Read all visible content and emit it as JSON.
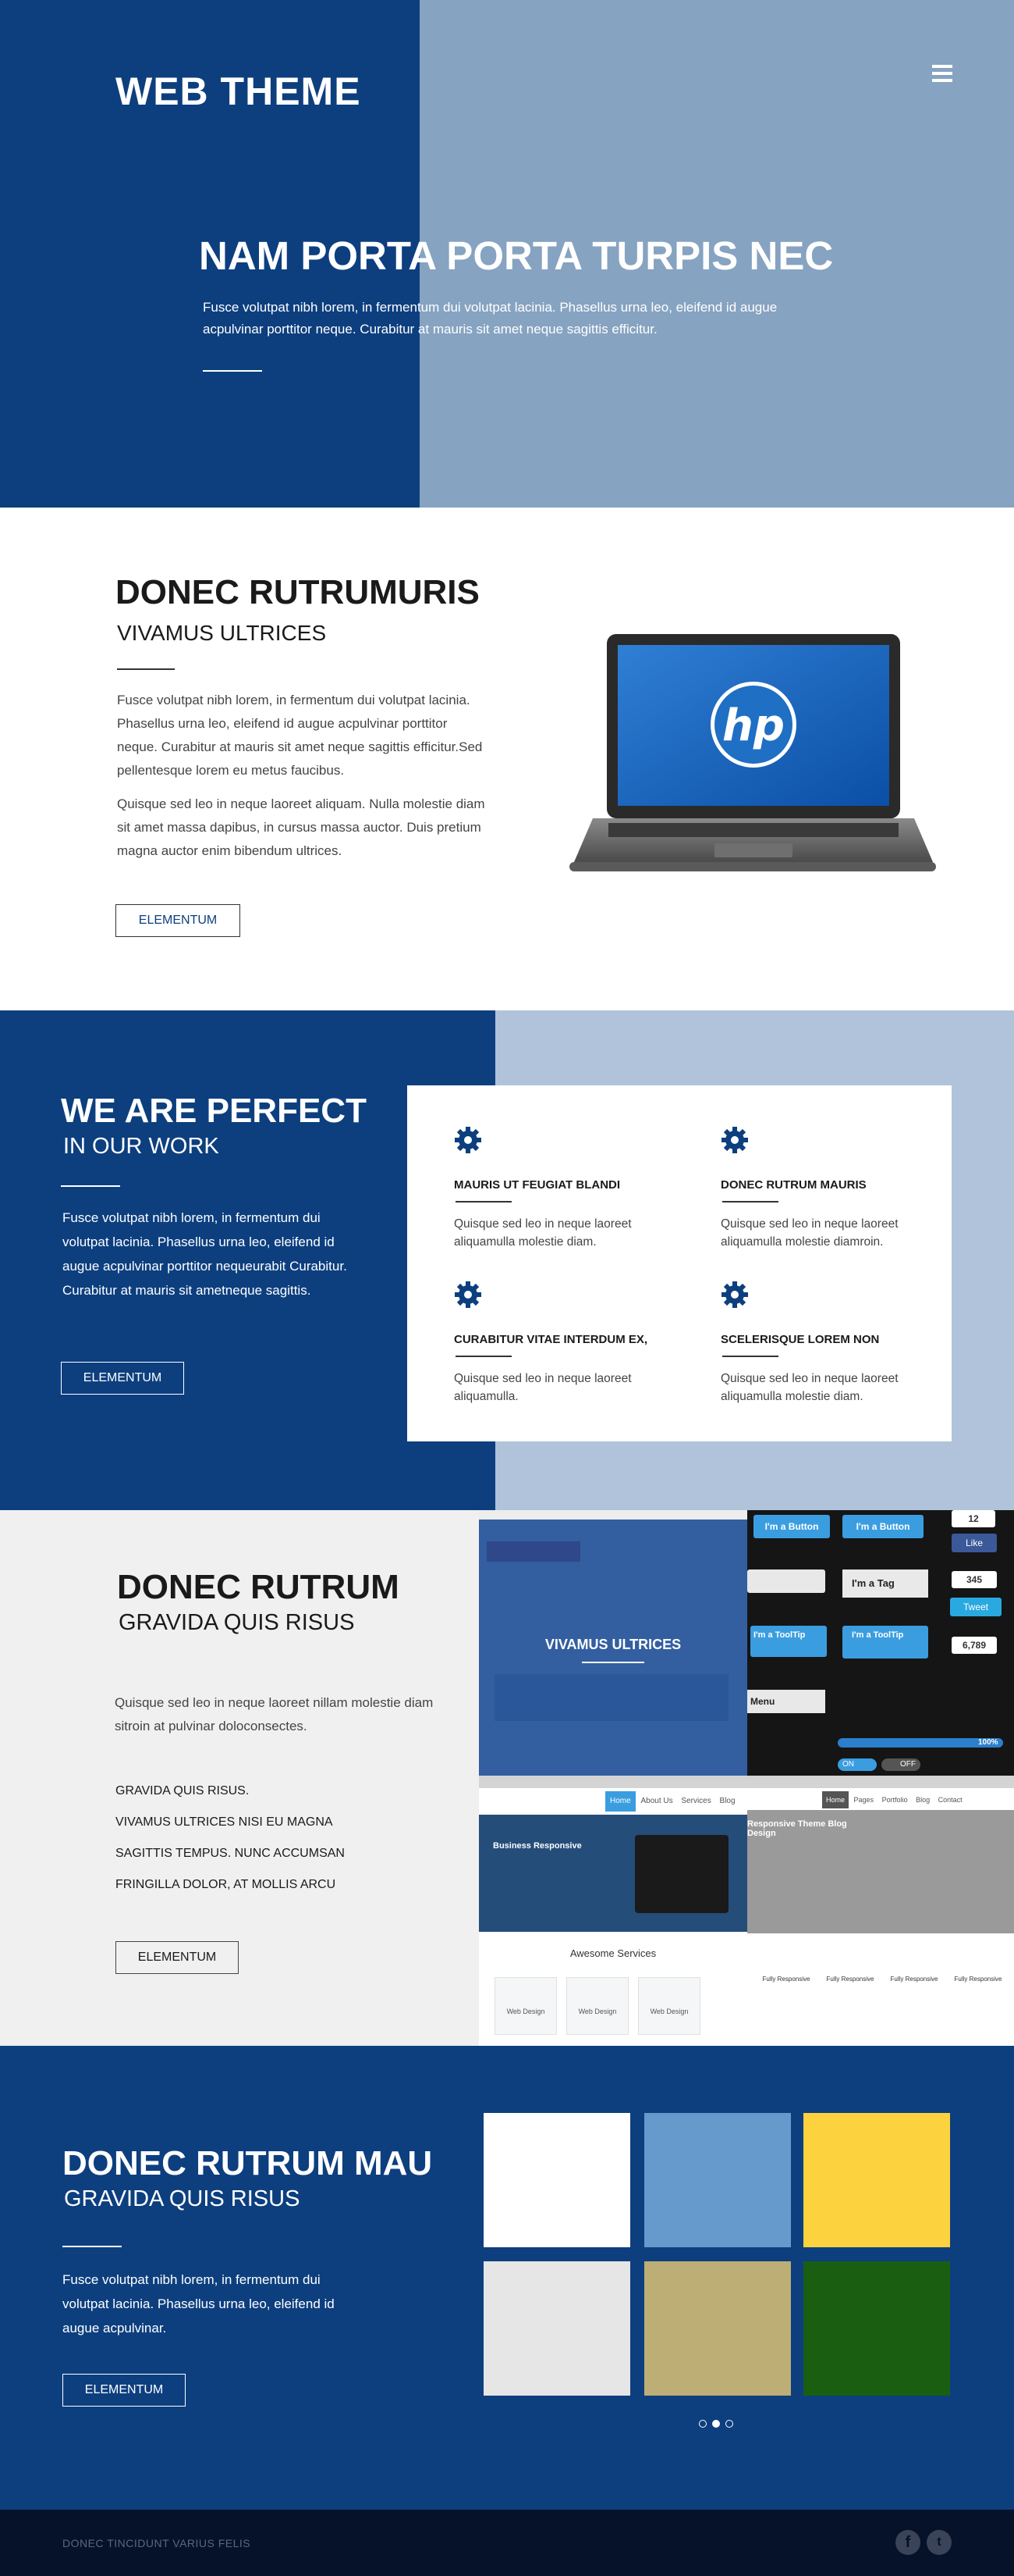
{
  "hero": {
    "brand": "WEB THEME",
    "title": "NAM PORTA PORTA TURPIS NEC",
    "text": "Fusce volutpat nibh lorem, in fermentum dui volutpat lacinia. Phasellus urna leo, eleifend id augue acpulvinar porttitor neque. Curabitur at mauris sit amet neque sagittis efficitur."
  },
  "product": {
    "title": "DONEC RUTRUMURIS",
    "subtitle": "VIVAMUS ULTRICES",
    "p1": "Fusce volutpat nibh lorem, in fermentum dui volutpat lacinia. Phasellus urna leo, eleifend id augue acpulvinar porttitor neque. Curabitur at mauris sit amet neque sagittis efficitur.Sed pellentesque lorem eu metus faucibus.",
    "p2": "Quisque sed leo in neque laoreet aliquam. Nulla molestie diam sit amet massa dapibus, in cursus massa auctor. Duis pretium magna auctor enim bibendum ultrices.",
    "button": "ELEMENTUM",
    "laptop_logo": "hp"
  },
  "perfect": {
    "title": "WE ARE PERFECT",
    "subtitle": "IN OUR WORK",
    "text": "Fusce volutpat nibh lorem, in fermentum dui volutpat lacinia. Phasellus urna leo, eleifend id augue acpulvinar porttitor nequeurabit Curabitur. Curabitur at mauris sit ametneque sagittis.",
    "button": "ELEMENTUM",
    "features": [
      {
        "icon": "gear-icon",
        "title": "MAURIS UT FEUGIAT BLANDI",
        "text": "Quisque sed leo in neque laoreet aliquamulla molestie diam."
      },
      {
        "icon": "gear-icon",
        "title": "DONEC RUTRUM MAURIS",
        "text": "Quisque sed leo in neque laoreet aliquamulla molestie diamroin."
      },
      {
        "icon": "gear-icon",
        "title": "CURABITUR VITAE INTERDUM EX,",
        "text": "Quisque sed leo in neque laoreet aliquamulla."
      },
      {
        "icon": "gear-icon",
        "title": "SCELERISQUE LOREM NON",
        "text": "Quisque sed leo in neque laoreet aliquamulla molestie diam."
      }
    ]
  },
  "templates": {
    "title": "DONEC RUTRUM",
    "subtitle": "GRAVIDA QUIS RISUS",
    "text": "Quisque sed leo in neque laoreet nillam molestie diam sitroin at pulvinar doloconsectes.",
    "list": [
      "GRAVIDA QUIS RISUS.",
      "VIVAMUS ULTRICES NISI EU MAGNA",
      "SAGITTIS TEMPUS. NUNC ACCUMSAN",
      "FRINGILLA DOLOR, AT MOLLIS ARCU"
    ],
    "button": "ELEMENTUM",
    "overlay_label": "VIVAMUS ULTRICES",
    "ui_kit": {
      "button1": "I'm a Button",
      "button2": "I'm a Button",
      "tag": "I'm a Tag",
      "tooltip1": "I'm a ToolTip",
      "tooltip2": "I'm a ToolTip",
      "count1": "12",
      "like": "Like",
      "count2": "345",
      "tweet": "Tweet",
      "count3": "6,789",
      "progress": "100%",
      "toggle_on": "ON",
      "toggle_off": "OFF",
      "menu": "Menu"
    },
    "shot_c": {
      "nav": [
        "Home",
        "About Us",
        "Services",
        "Blog"
      ],
      "hero": "Business Responsive",
      "heading": "Awesome Services",
      "cards": [
        "Web Design",
        "Web Design",
        "Web Design"
      ]
    },
    "shot_d": {
      "nav": [
        "Home",
        "Pages",
        "Portfolio",
        "Blog",
        "Contact"
      ],
      "hero": "Responsive Theme Blog Design",
      "cols": [
        "Fully Responsive",
        "Fully Responsive",
        "Fully Responsive",
        "Fully Responsive"
      ]
    }
  },
  "palette": {
    "title": "DONEC RUTRUM MAU",
    "subtitle": "GRAVIDA QUIS RISUS",
    "text": "Fusce volutpat nibh lorem, in fermentum dui volutpat lacinia. Phasellus urna leo, eleifend id augue acpulvinar.",
    "button": "ELEMENTUM",
    "swatches": [
      "#ffffff",
      "#6699cc",
      "#fdd23f",
      "#e6e6e6",
      "#bcae75",
      "#1a5f11"
    ],
    "slider_dots": 3,
    "active_dot": 1
  },
  "footer": {
    "text": "DONEC TINCIDUNT VARIUS FELIS",
    "social": [
      "facebook-icon",
      "twitter-icon"
    ]
  },
  "colors": {
    "primary": "#0d3f7f",
    "hero_light": "#86a3c1",
    "perfect_light": "#b0c3da",
    "footer": "#051229"
  }
}
